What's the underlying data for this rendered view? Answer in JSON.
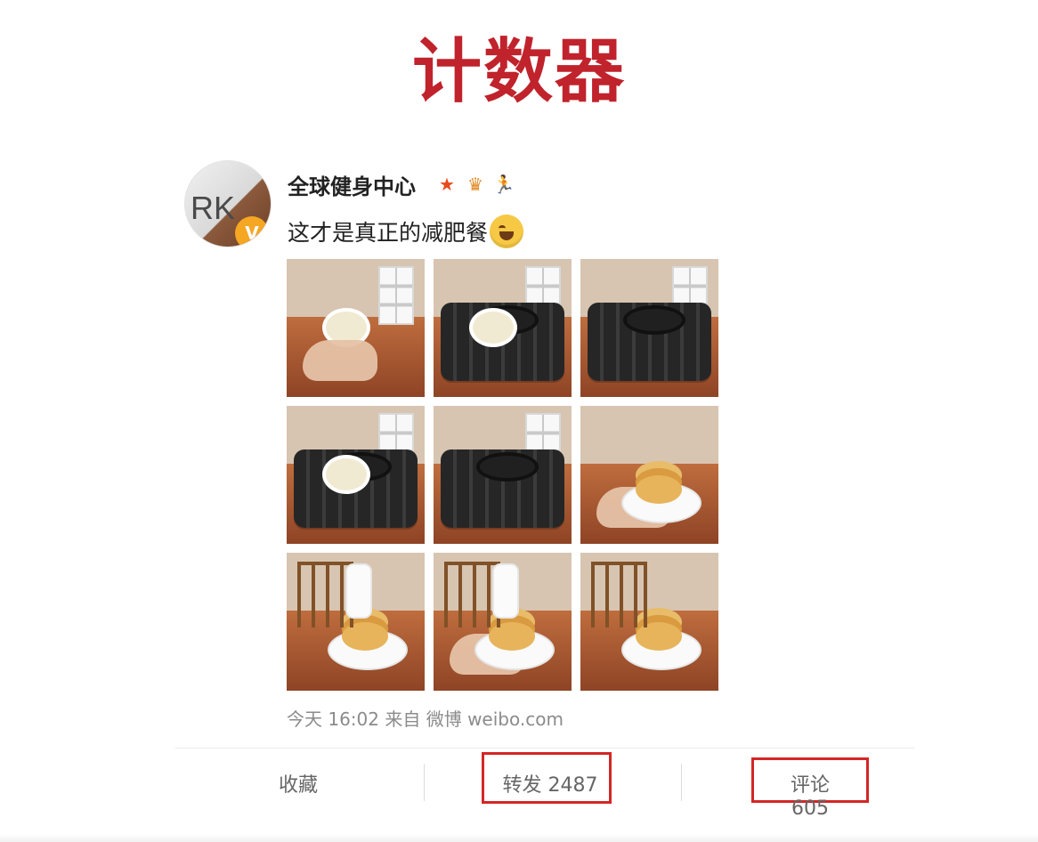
{
  "slide": {
    "title": "计数器"
  },
  "post": {
    "user_name": "全球健身中心",
    "avatar_text": "RK",
    "avatar_badge": "V",
    "badges": [
      {
        "name": "star-icon",
        "symbol": "★",
        "color": "#e84a1a"
      },
      {
        "name": "crown-level-icon",
        "symbol": "♛",
        "color": "#e08a24"
      },
      {
        "name": "runner-icon",
        "symbol": "🏃",
        "color": "#1b9b45"
      }
    ],
    "text": "这才是真正的减肥餐",
    "meta": "今天 16:02 来自 微博 weibo.com",
    "actions": {
      "favorite": "收藏",
      "repost": "转发 2487",
      "comment": "评论 605"
    },
    "photos": [
      {
        "scene": "cup-in-hand"
      },
      {
        "scene": "pouring-at-stove"
      },
      {
        "scene": "empty-pan-on-stove"
      },
      {
        "scene": "oil-on-stove"
      },
      {
        "scene": "pancake-in-pan"
      },
      {
        "scene": "pancake-on-plate"
      },
      {
        "scene": "pouring-on-pancakes"
      },
      {
        "scene": "milk-bottle-pancakes"
      },
      {
        "scene": "pancake-stack"
      }
    ]
  },
  "colors": {
    "title_red": "#c0232c",
    "highlight_red": "#d32626",
    "meta_gray": "#8b8b8b"
  }
}
